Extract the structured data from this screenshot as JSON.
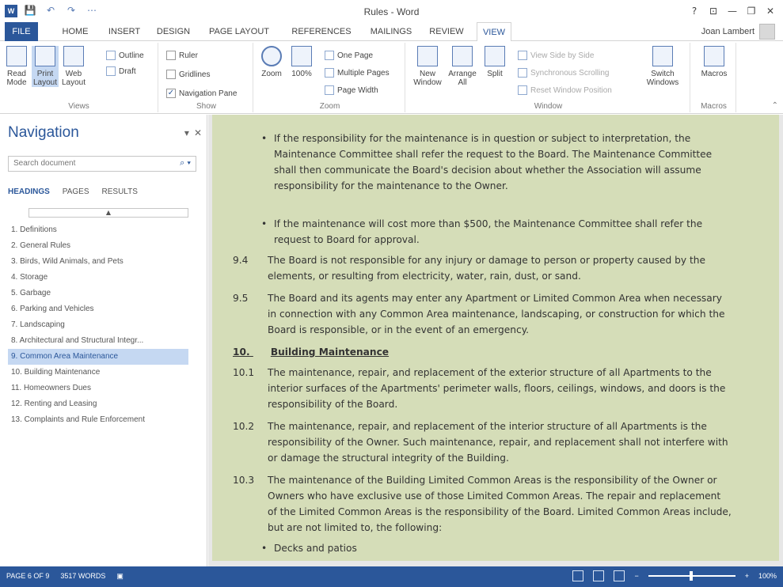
{
  "window": {
    "title": "Rules - Word",
    "controls": [
      "?",
      "⊡",
      "—",
      "❐",
      "✕"
    ]
  },
  "qat": {
    "save": "💾",
    "undo": "↶",
    "redo": "↷",
    "customize": "⋯"
  },
  "tabs": [
    "FILE",
    "HOME",
    "INSERT",
    "DESIGN",
    "PAGE LAYOUT",
    "REFERENCES",
    "MAILINGS",
    "REVIEW",
    "VIEW"
  ],
  "active_tab": "VIEW",
  "user": {
    "name": "Joan Lambert"
  },
  "ribbon": {
    "views": {
      "label": "Views",
      "read_mode": "Read Mode",
      "print_layout": "Print Layout",
      "web_layout": "Web Layout",
      "outline": "Outline",
      "draft": "Draft"
    },
    "show": {
      "label": "Show",
      "ruler": "Ruler",
      "gridlines": "Gridlines",
      "navigation_pane": "Navigation Pane"
    },
    "zoom": {
      "label": "Zoom",
      "zoom": "Zoom",
      "hundred": "100%",
      "one_page": "One Page",
      "multiple_pages": "Multiple Pages",
      "page_width": "Page Width"
    },
    "window": {
      "label": "Window",
      "new_window": "New Window",
      "arrange_all": "Arrange All",
      "split": "Split",
      "view_side_by_side": "View Side by Side",
      "synchronous_scrolling": "Synchronous Scrolling",
      "reset_window_position": "Reset Window Position",
      "switch_windows": "Switch Windows"
    },
    "macros": {
      "label": "Macros",
      "macros": "Macros"
    }
  },
  "navigation": {
    "title": "Navigation",
    "search_placeholder": "Search document",
    "tabs": [
      "HEADINGS",
      "PAGES",
      "RESULTS"
    ],
    "active_tab": "HEADINGS",
    "headings": [
      "1. Definitions",
      "2. General Rules",
      "3. Birds, Wild Animals, and Pets",
      "4. Storage",
      "5. Garbage",
      "6. Parking and Vehicles",
      "7. Landscaping",
      "8. Architectural and Structural Integr...",
      "9. Common Area Maintenance",
      "10. Building Maintenance",
      "11. Homeowners Dues",
      "12. Renting and Leasing",
      "13. Complaints and Rule Enforcement"
    ],
    "selected_index": 8
  },
  "document": {
    "bullet1": "If the responsibility for the maintenance is in question or subject to interpretation, the Maintenance Committee shall refer the request to the Board. The Maintenance Committee shall then communicate the Board's decision about whether the Association will assume responsibility for the maintenance to the Owner.",
    "bullet2": "If the maintenance will cost more than $500, the Maintenance Committee shall refer the request to Board for approval.",
    "p94_num": "9.4",
    "p94": "The Board is not responsible for any injury or damage to person or property caused by the elements, or resulting from electricity, water, rain, dust, or sand.",
    "p95_num": "9.5",
    "p95": "The Board and its agents may enter any Apartment or Limited Common Area when necessary in connection with any Common Area maintenance, landscaping, or construction for which the Board is responsible, or in the event of an emergency.",
    "h10_num": "10.",
    "h10": "Building Maintenance",
    "p101_num": "10.1",
    "p101": "The maintenance, repair, and replacement of the exterior structure of all Apartments to the interior surfaces of the Apartments' perimeter walls, floors, ceilings, windows, and doors is the responsibility of the Board.",
    "p102_num": "10.2",
    "p102": "The maintenance, repair, and replacement of the interior structure of all Apartments is the responsibility of the Owner. Such maintenance, repair, and replacement shall not interfere with or damage the structural integrity of the Building.",
    "p103_num": "10.3",
    "p103": "The maintenance of the Building Limited Common Areas is the responsibility of the Owner or Owners who have exclusive use of those Limited Common Areas. The repair and replacement of the Limited Common Areas is the responsibility of the Board. Limited Common Areas include, but are not limited to, the following:",
    "bullet3": "Decks and patios"
  },
  "status": {
    "page": "PAGE 6 OF 9",
    "words": "3517 WORDS",
    "zoom": "100%",
    "zoom_minus": "−",
    "zoom_plus": "+"
  }
}
